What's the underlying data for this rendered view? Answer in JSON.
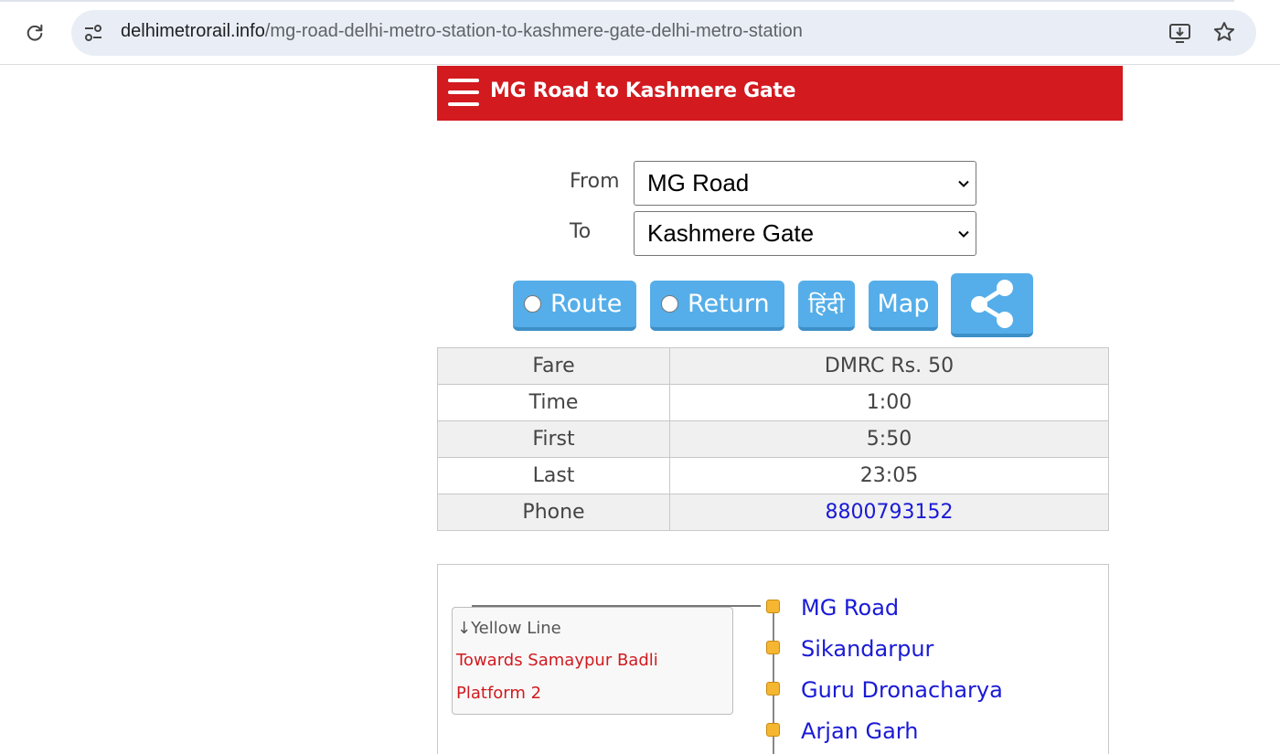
{
  "browser": {
    "url_host": "delhimetrorail.info",
    "url_path": "/mg-road-delhi-metro-station-to-kashmere-gate-delhi-metro-station"
  },
  "header": {
    "title": "MG Road to Kashmere Gate"
  },
  "form": {
    "from_label": "From",
    "from_value": "MG Road",
    "to_label": "To",
    "to_value": "Kashmere Gate"
  },
  "buttons": {
    "route": "Route",
    "return": "Return",
    "hindi": "हिंदी",
    "map": "Map"
  },
  "info": {
    "rows": [
      {
        "key": "Fare",
        "value": "DMRC Rs. 50"
      },
      {
        "key": "Time",
        "value": "1:00"
      },
      {
        "key": "First",
        "value": "5:50"
      },
      {
        "key": "Last",
        "value": "23:05"
      },
      {
        "key": "Phone",
        "value": "8800793152"
      }
    ]
  },
  "route": {
    "line_name": "↓Yellow Line",
    "towards": "Towards Samaypur Badli",
    "platform": "Platform 2",
    "stations": [
      "MG Road",
      "Sikandarpur",
      "Guru Dronacharya",
      "Arjan Garh"
    ]
  },
  "colors": {
    "header_red": "#d21a1f",
    "button_blue": "#55aee9",
    "link_blue": "#1a1ad6",
    "station_dot": "#f5b731"
  }
}
